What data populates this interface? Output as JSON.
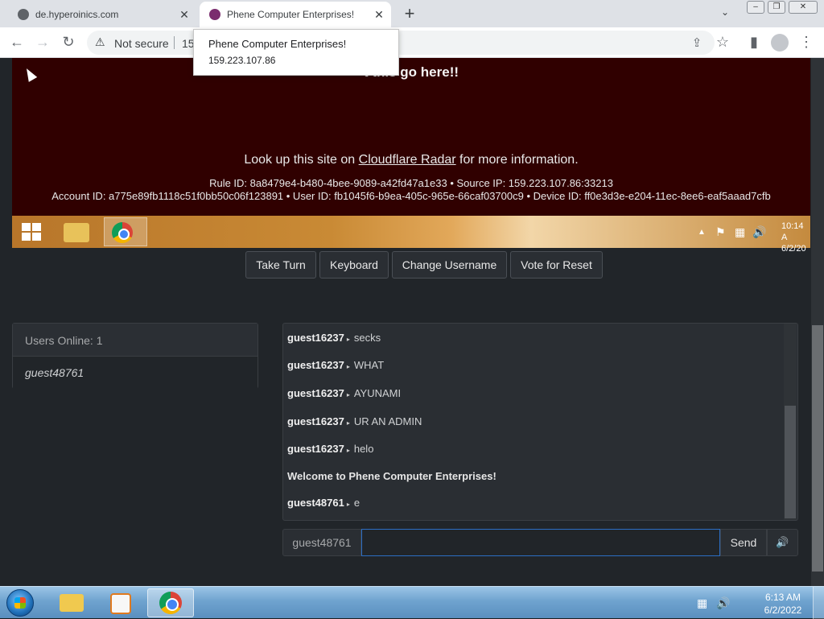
{
  "browser": {
    "tabs": [
      {
        "title": "de.hyperoinics.com",
        "active": false
      },
      {
        "title": "Phene Computer Enterprises!",
        "active": true
      }
    ],
    "new_tab_icon": "+",
    "tab_close_icon": "✕",
    "tab_search_icon": "⌄",
    "window_controls": [
      "–",
      "❐",
      "✕"
    ],
    "security": {
      "icon": "⚠",
      "label": "Not secure"
    },
    "url_fragment": "15",
    "tooltip": {
      "title": "Phene Computer Enterprises!",
      "subtitle": "159.223.107.86"
    },
    "toolbar_icons": {
      "back": "←",
      "forward": "→",
      "reload": "↻",
      "share": "⇪",
      "bookmark": "☆",
      "sidepanel": "▮",
      "menu": "⋮"
    }
  },
  "vm_screen": {
    "heading": "t this go here!!",
    "lookup_pre": "Look up this site on ",
    "lookup_link": "Cloudflare Radar",
    "lookup_post": " for more information.",
    "rule_line": "Rule ID: 8a8479e4-b480-4bee-9089-a42fd47a1e33 • Source IP: 159.223.107.86:33213",
    "account_line": "Account ID: a775e89fb1118c51f0bb50c06f123891 • User ID: fb1045f6-b9ea-405c-965e-66caf03700c9 • Device ID: ff0e3d3e-e204-11ec-8ee6-eaf5aaad7cfb",
    "taskbar": {
      "time": "10:14 A",
      "date": "6/2/20",
      "tray_icons": [
        "▲",
        "⚑",
        "▦",
        "🔊"
      ]
    }
  },
  "controls": {
    "take_turn": "Take Turn",
    "keyboard": "Keyboard",
    "change_username": "Change Username",
    "vote_reset": "Vote for Reset"
  },
  "users_panel": {
    "header": "Users Online: 1",
    "users": [
      "guest48761"
    ]
  },
  "chat": {
    "arrow": "▸",
    "messages": [
      {
        "user": "guest16237",
        "text": "secks"
      },
      {
        "user": "guest16237",
        "text": "WHAT"
      },
      {
        "user": "guest16237",
        "text": "AYUNAMI"
      },
      {
        "user": "guest16237",
        "text": "UR AN ADMIN"
      },
      {
        "user": "guest16237",
        "text": "helo"
      },
      {
        "system": "Welcome to Phene Computer Enterprises!"
      },
      {
        "user": "guest48761",
        "text": "e"
      }
    ]
  },
  "chat_input": {
    "username": "guest48761",
    "value": "",
    "send_label": "Send",
    "volume_icon": "🔊"
  },
  "host_taskbar": {
    "time": "6:13 AM",
    "date": "6/2/2022",
    "tray_icons": [
      "▦",
      "🔊"
    ]
  }
}
